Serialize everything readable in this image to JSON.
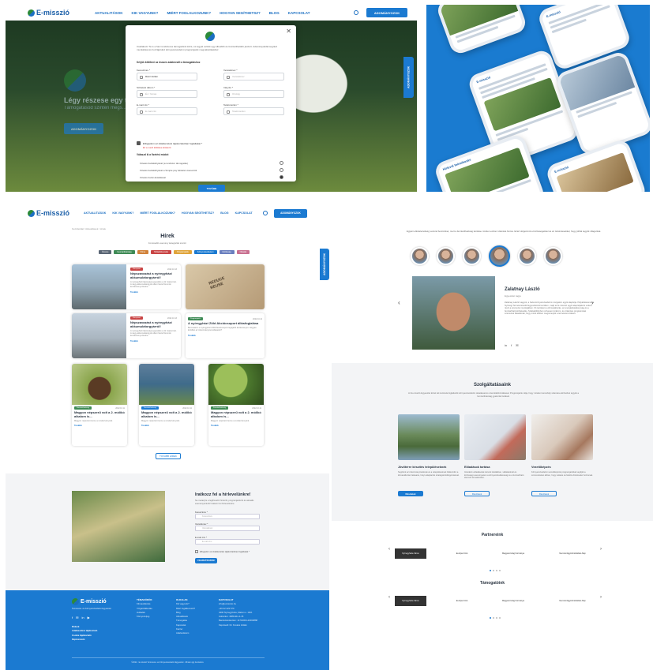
{
  "brand": {
    "name": "E-misszió",
    "tagline": "Természet- és Környezetvédelmi Egyesület"
  },
  "nav": {
    "items": [
      "AKTUALITÁSOK",
      "KIK VAGYUNK?",
      "MIÉRT FOGLALKOZUNK?",
      "HOGYAN SEGÍTHETSZ?",
      "BLOG",
      "KAPCSOLAT"
    ],
    "cta": "ADOMÁNYOZOK",
    "side_tab": "ADOMÁNYOZOK"
  },
  "hero": {
    "title": "Légy részese egy t...",
    "subtitle": "Támogatásod szintén megs...",
    "button": "ADOMÁNYOZOK"
  },
  "modal": {
    "intro": "Csatlakozz Te is a havi rendszeres támogatóink közé, és tegyél velünk egy élhetőbb és fenntarthatóbb jövőért. Adományoddal segíted munkánkat és hozzájárulsz környezetvédelmi programjaink megvalósításához.",
    "note": "Kérjük kitölteni az összes adatmezőt a támogatáshoz",
    "fields": [
      {
        "label": "Keresztnév *",
        "value": "Rácz Zoltán"
      },
      {
        "label": "Vezetéknév *",
        "value": "Vezetéknév"
      },
      {
        "label": "Születési dátum *",
        "value": "Év / hónap"
      },
      {
        "label": "Irányító *",
        "value": "Ország"
      },
      {
        "label": "E-mail cím *",
        "value": "E-mail cím"
      },
      {
        "label": "Telefonszám *",
        "value": "Telefonszám"
      }
    ],
    "consent": "Elfogadom az Adatkezelési tájékoztatóban foglaltakat *",
    "required": "Ez a mező kitöltése kötelező",
    "group": "Válaszd ki a fizetési módot",
    "options": [
      "Fizetés bankkártyával (a rendszer támogatás)",
      "Fizetés bankkártyával a Simple pay felületén keresztül",
      "Fizetés banki átutalással"
    ],
    "submit": "TOVÁBB"
  },
  "phones": {
    "app": "E-misszió",
    "post": "Hírlevél feliratkozás"
  },
  "news": {
    "breadcrumb": "Kezdőoldal / Aktualitások / Hírek",
    "title": "Hírek",
    "subtitle": "Fontosabb esemény kategóriák szerint",
    "chips": [
      "Összes",
      "Fenntarthatóság",
      "Klíma",
      "Hulladékkezelés",
      "Programjaink",
      "Környezetvédelem",
      "Közösség",
      "Oktatás"
    ],
    "chip_colors": [
      "#5a6675",
      "#3f8b56",
      "#d1823a",
      "#c94444",
      "#e0a43a",
      "#1b7ad1",
      "#6a7fbf",
      "#c97090"
    ],
    "cards": [
      {
        "tag": "Környezet",
        "date": "2022.10.13",
        "title": "Népszavazást a nyíregyházi akkumulátorgyárról!",
        "text": "A nyíregyházi lakossági egyesülés a 42. lépést tett. A nagy akkumulátorgyár elleni hazai fórumok kezdeményezésére.",
        "more": "Tovább"
      },
      {
        "tag": "Környezet",
        "date": "2022.10.13",
        "title": "Népszavazást a nyíregyházi akkumulátorgyárról!",
        "text": "A nyíregyházi lakossági egyesülés a 42. lépést tett. A nagy akkumulátorgyár elleni hazai fórumok kezdeményezésére.",
        "more": "Tovább"
      },
      {
        "tag": "Programjaink",
        "date": "2022.10.12",
        "title": "A nyíregyházi Zöld Akciócsoport állásfoglalása",
        "text": "Bemutatom a nyíregyházi Zöld Akciócsoport legújabb közleményét. Hogyan küzdhet az önkormányzat érdekeiért?",
        "more": "Tovább"
      },
      {
        "tag": "Fenntarthatóság",
        "date": "2022.10.11",
        "title": "Magyon népszerű volt a 2. mólikó alkalom is...",
        "text": "Magyon népszerű lenne a rendezvényünk.",
        "more": "Tovább"
      },
      {
        "tag": "Fenntarthatóság",
        "date": "2022.10.11",
        "title": "Magyon népszerű volt a 2. mólikó alkalom is...",
        "text": "Magyon népszerű lenne a rendezvényünk.",
        "more": "Tovább"
      },
      {
        "tag": "Fenntarthatóság",
        "date": "2022.10.11",
        "title": "Magyon népszerű volt a 2. mólikó alkalom is...",
        "text": "Magyon népszerű lenne a rendezvényünk.",
        "more": "Tovább"
      }
    ],
    "more_button": "TOVÁBB HÍREK"
  },
  "newsletter": {
    "title": "Iratkozz fel a hírlevelünkre!",
    "text": "Ne maradj le a legfrissebb hírekről, programjainkról és aktuális eseményeinkről! Iratkozz fel hírlevelünkre.",
    "fields": [
      {
        "label": "Keresztnév *",
        "value": "Keresztnév"
      },
      {
        "label": "Vezetéknév *",
        "value": "Vezetéknév"
      },
      {
        "label": "E-mail cím *",
        "value": "E-mail cím"
      }
    ],
    "consent": "Elfogadom az Adatkezelési tájékoztatóban foglaltakat *",
    "button": "FELIRATKOZOM"
  },
  "footer": {
    "about": "Természet- és Környezetvédelmi Egyesület",
    "links": [
      "Rólunk",
      "Adatkezelési tájékoztató",
      "Cookie tájékoztató",
      "Impresszum"
    ],
    "c1": {
      "title": "TÉMAKÖRÖK",
      "items": [
        "Klímaváltozás",
        "Vízgazdálkodás",
        "Hulladék",
        "Környezetjog"
      ]
    },
    "c2": {
      "title": "OLDALAK",
      "items": [
        "Kik vagyunk?",
        "Miért foglalkozunk?",
        "Blog",
        "Aktualitások",
        "Támogatás",
        "Kapcsolat",
        "Karrier",
        "Adatvédelem"
      ]
    },
    "c3": {
      "title": "KAPCSOLAT",
      "items": [
        "info@emisszio.hu",
        "+36 42 423 579",
        "4400 Nyíregyháza, Malom u. 18/A",
        "Adószám: 18811111-1-15",
        "Bankszámlaszám: 11744004-20033888",
        "Képviselő: Dr. Kovács Zoltán"
      ]
    },
    "copyright": "©2022 · E-misszió Természet- és Környezetvédelmi Egyesület · Minden jog fenntartva"
  },
  "team": {
    "intro": "Egyéni elkötelezettség vezérel bennünket, mert a fenntarthatóság kérdése minden ember számára fontos. Ezért dolgozunk a közösségekkel és az önkéntesekkel, hogy jobbá tegyük világunkat.",
    "name": "Zalatnay László",
    "role": "Egyesület tagja",
    "bio": "Zalatnay László vagyok, a hazai környezetvédelmi mozgalom egyik alapítója. Pályafutásomat a Nyírségi Természetvédő Egyesületnél kezdtem, majd az E-misszió egyik alapítójaként vettem részt a szervezet munkájában. Fő területem a klímaváltozás, az energiahatékonyság és a fenntartható közlekedés. Szabadidőmben szívesen túrázom, és önkéntes programokat szervezek fiataloknak, hogy minél többen megismerjék a természet értékeit."
  },
  "services": {
    "title": "Szolgáltatásaink",
    "text": "Az E-misszió Egyesület közel két évtizede foglalkozik környezetvédelmi oktatással és szemléletformálással. Programjaink célja, hogy minden korosztály számára elérhetővé tegyük a fenntarthatóság gyakorlati tudását.",
    "items": [
      {
        "title": "Jövőtérre készítés településeknek",
        "text": "Segítünk az önkormányzatoknak és a településeknek felkészülni a klímaváltozás hatásaira, helyi adaptációs stratégiák kidolgozásával.",
        "button": "Részletek"
      },
      {
        "title": "Előadások tartása",
        "text": "Interaktív előadásokat tartunk iskolákban, vállalatoknál és közösségi eseményeken a környezettudatosság és a fenntartható életmód témakörében.",
        "button": "Részletek"
      },
      {
        "title": "Vezetőképzés",
        "text": "Környezetvédelmi vezetőképzési programjainkkal segítjük a szervezeteket abban, hogy tudatos és felelős döntéseket hozzanak.",
        "button": "Részletek"
      }
    ]
  },
  "partners": {
    "title": "Partnereink",
    "supporters": "Támogatóink",
    "logos": [
      "Nyíregyháza Város",
      "Európai Unió",
      "Magyarország Kormánya",
      "Nemzeti Együttműködési Alap"
    ]
  }
}
